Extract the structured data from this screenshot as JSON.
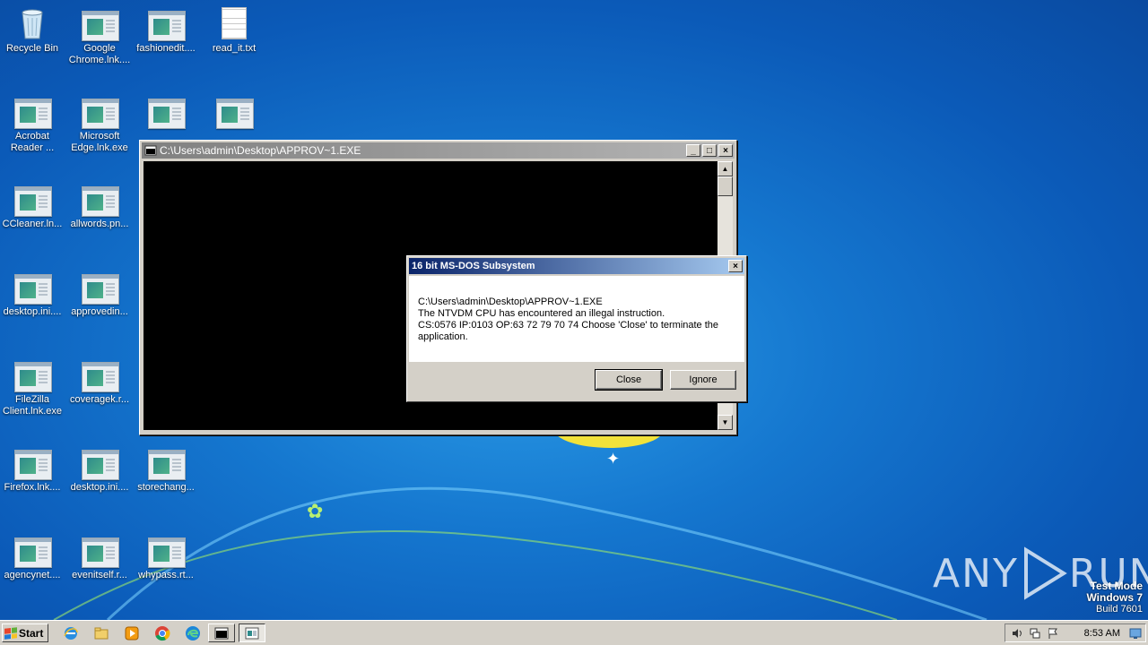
{
  "desktop": {
    "icons": [
      {
        "label": "Recycle Bin",
        "glyph": "recycle-bin-icon"
      },
      {
        "label": "Google Chrome.lnk....",
        "glyph": "app-icon"
      },
      {
        "label": "fashionedit....",
        "glyph": "app-icon"
      },
      {
        "label": "read_it.txt",
        "glyph": "text-file-icon"
      },
      {
        "label": "Acrobat Reader ...",
        "glyph": "app-icon"
      },
      {
        "label": "Microsoft Edge.lnk.exe",
        "glyph": "app-icon"
      },
      {
        "label": "",
        "glyph": "app-icon"
      },
      {
        "label": "",
        "glyph": "app-icon"
      },
      {
        "label": "CCleaner.ln...",
        "glyph": "app-icon"
      },
      {
        "label": "allwords.pn...",
        "glyph": "app-icon"
      },
      {
        "label": "desktop.ini....",
        "glyph": "app-icon"
      },
      {
        "label": "approvedin...",
        "glyph": "app-icon"
      },
      {
        "label": "FileZilla Client.lnk.exe",
        "glyph": "app-icon"
      },
      {
        "label": "coveragek.r...",
        "glyph": "app-icon"
      },
      {
        "label": "Firefox.lnk....",
        "glyph": "app-icon"
      },
      {
        "label": "desktop.ini....",
        "glyph": "app-icon"
      },
      {
        "label": "storechang...",
        "glyph": "app-icon"
      },
      {
        "label": "agencynet....",
        "glyph": "app-icon"
      },
      {
        "label": "evenitself.r...",
        "glyph": "app-icon"
      },
      {
        "label": "whypass.rt...",
        "glyph": "app-icon"
      }
    ]
  },
  "console_window": {
    "title": "C:\\Users\\admin\\Desktop\\APPROV~1.EXE",
    "minimize": "_",
    "maximize": "□",
    "close": "×",
    "scroll_up": "▲",
    "scroll_down": "▼"
  },
  "dialog": {
    "title": "16 bit MS-DOS Subsystem",
    "close": "×",
    "line1": "C:\\Users\\admin\\Desktop\\APPROV~1.EXE",
    "line2": "The NTVDM CPU has encountered an illegal instruction.",
    "line3": "CS:0576 IP:0103 OP:63 72 79 70 74 Choose 'Close' to terminate the",
    "line4": "application.",
    "close_button": "Close",
    "ignore_button": "Ignore"
  },
  "taskbar": {
    "start_label": "Start",
    "clock": "8:53 AM"
  },
  "watermark": {
    "line1": "Test Mode",
    "line2": "Windows 7",
    "line3": "Build 7601"
  },
  "brand": {
    "left": "ANY",
    "right": "RUN"
  },
  "colors": {
    "desktop_blue": "#1577cf",
    "dialog_title": "#0a246a",
    "console_bg": "#000000"
  }
}
